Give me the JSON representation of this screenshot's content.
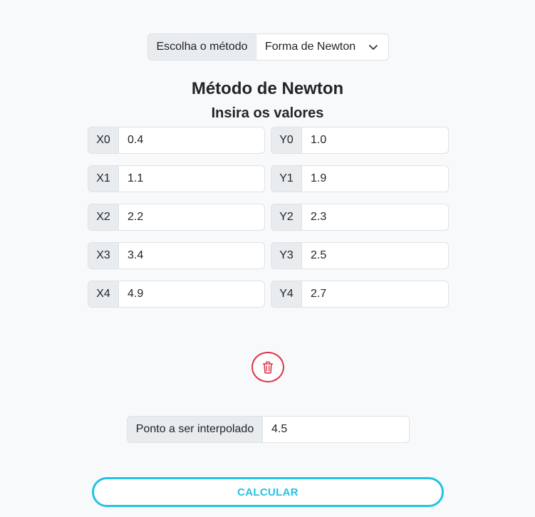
{
  "method_selector": {
    "label": "Escolha o método",
    "selected": "Forma de Newton"
  },
  "title": "Método de Newton",
  "subtitle": "Insira os valores",
  "rows": [
    {
      "x_label": "X0",
      "x_value": "0.4",
      "y_label": "Y0",
      "y_value": "1.0"
    },
    {
      "x_label": "X1",
      "x_value": "1.1",
      "y_label": "Y1",
      "y_value": "1.9"
    },
    {
      "x_label": "X2",
      "x_value": "2.2",
      "y_label": "Y2",
      "y_value": "2.3"
    },
    {
      "x_label": "X3",
      "x_value": "3.4",
      "y_label": "Y3",
      "y_value": "2.5"
    },
    {
      "x_label": "X4",
      "x_value": "4.9",
      "y_label": "Y4",
      "y_value": "2.7"
    }
  ],
  "interpolation": {
    "label": "Ponto a ser interpolado",
    "value": "4.5"
  },
  "calculate_label": "CALCULAR",
  "colors": {
    "danger": "#dc3545",
    "accent": "#22c3e6",
    "addon_bg": "#e9ecef",
    "page_bg": "#f8f9fa"
  }
}
